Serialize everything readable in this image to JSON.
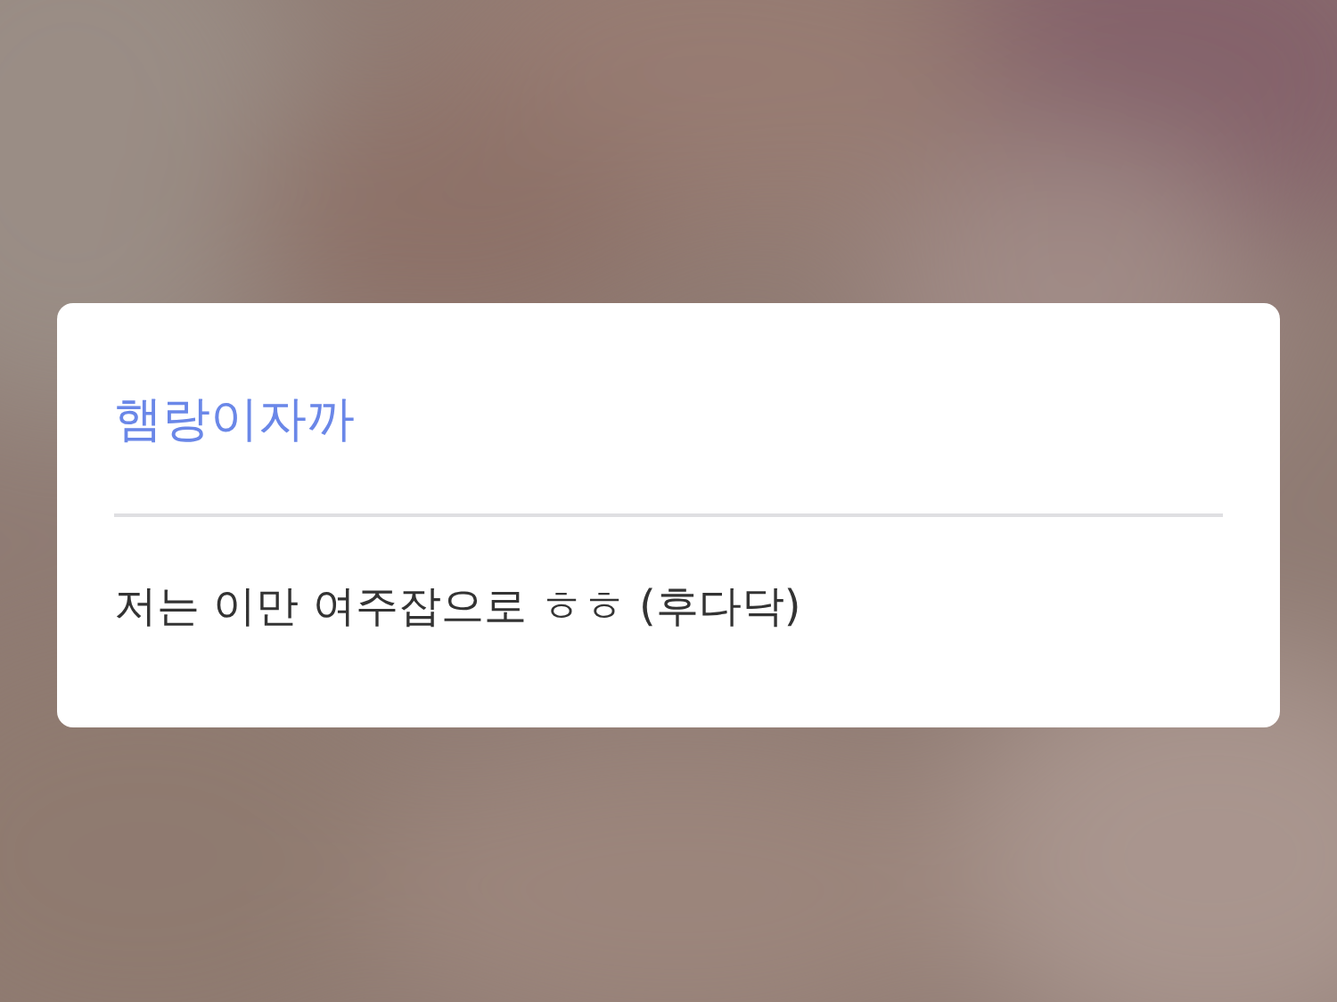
{
  "dialog": {
    "title": "햄랑이자까",
    "message": "저는 이만 여주잡으로 ㅎㅎ (후다닥)"
  }
}
